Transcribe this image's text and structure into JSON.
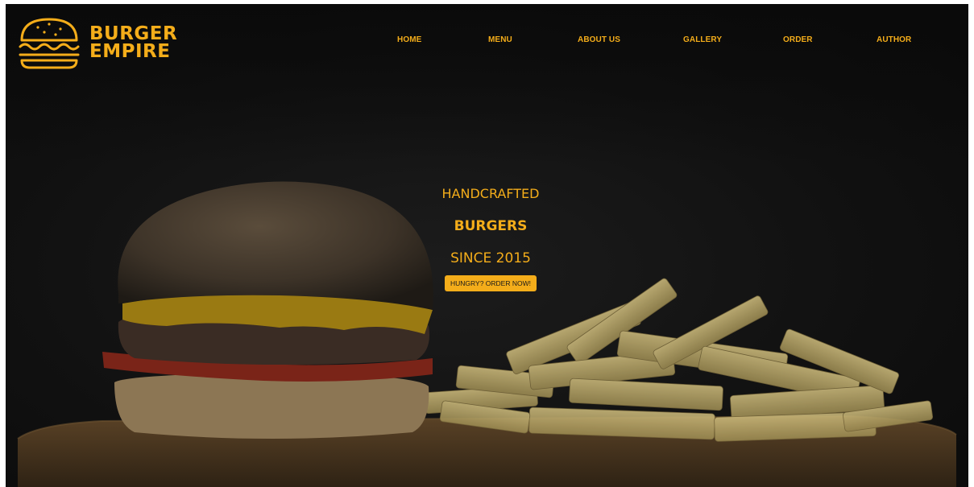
{
  "brand": {
    "line1": "BURGER",
    "line2": "EMPIRE",
    "icon": "burger-icon",
    "color": "#f4ad1a"
  },
  "nav": {
    "items": [
      {
        "label": "HOME"
      },
      {
        "label": "MENU"
      },
      {
        "label": "ABOUT US"
      },
      {
        "label": "GALLERY"
      },
      {
        "label": "ORDER"
      },
      {
        "label": "AUTHOR"
      }
    ]
  },
  "hero": {
    "line1": "HANDCRAFTED",
    "line2": "BURGERS",
    "line3": "SINCE 2015",
    "cta_label": "HUNGRY? ORDER NOW!",
    "background_image": "burger-and-fries-photo"
  },
  "colors": {
    "accent": "#f4ad1a",
    "background": "#111111"
  }
}
